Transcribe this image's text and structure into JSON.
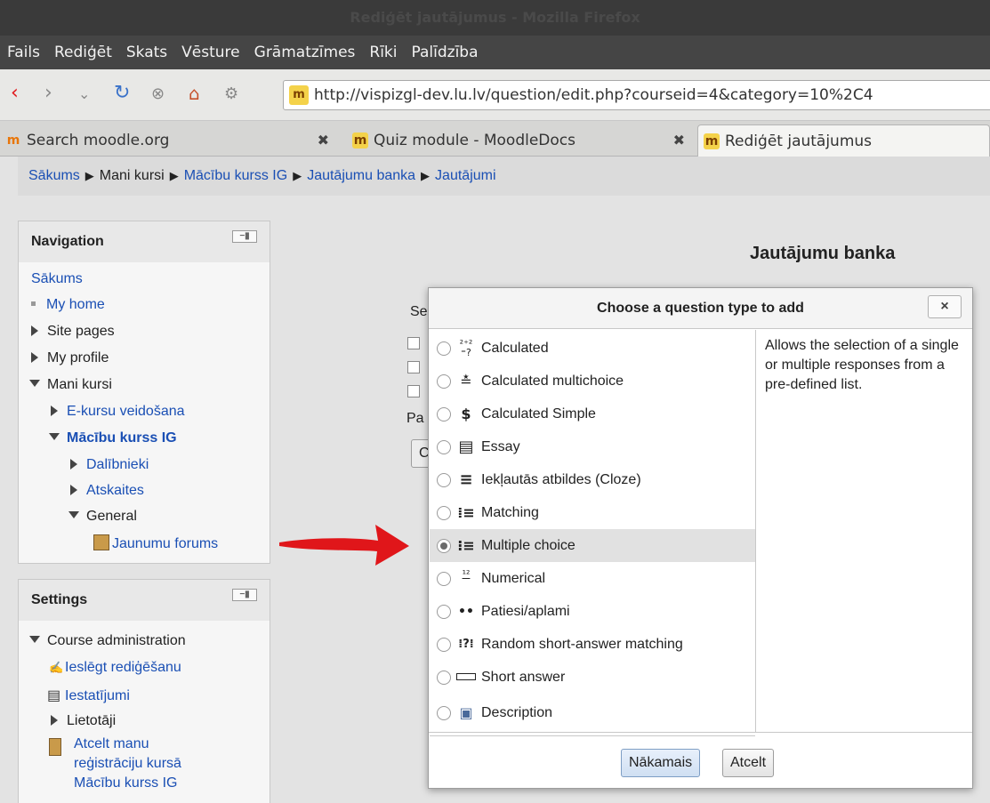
{
  "window": {
    "title": "Rediģēt jautājumus - Mozilla Firefox"
  },
  "menubar": {
    "items": [
      "Fails",
      "Rediģēt",
      "Skats",
      "Vēsture",
      "Grāmatzīmes",
      "Rīki",
      "Palīdzība"
    ]
  },
  "urlbar": {
    "url": "http://vispizgl-dev.lu.lv/question/edit.php?courseid=4&category=10%2C4"
  },
  "tabs": [
    {
      "label": "Search moodle.org",
      "icon": "moodle-org-favicon"
    },
    {
      "label": "Quiz module - MoodleDocs",
      "icon": "moodle-favicon"
    },
    {
      "label": "Rediģēt jautājumus",
      "icon": "moodle-favicon"
    }
  ],
  "breadcrumb": [
    {
      "label": "Sākums",
      "link": true
    },
    {
      "label": "Mani kursi",
      "link": false
    },
    {
      "label": "Mācību kurss IG",
      "link": true
    },
    {
      "label": "Jautājumu banka",
      "link": true
    },
    {
      "label": "Jautājumi",
      "link": true
    }
  ],
  "breadcrumb_separator": "▶",
  "navigation": {
    "title": "Navigation",
    "items": [
      {
        "label": "Sākums"
      },
      {
        "label": "My home"
      },
      {
        "label": "Site pages"
      },
      {
        "label": "My profile"
      },
      {
        "label": "Mani kursi"
      },
      {
        "label": "E-kursu veidošana"
      },
      {
        "label": "Mācību kurss IG"
      },
      {
        "label": "Dalībnieki"
      },
      {
        "label": "Atskaites"
      },
      {
        "label": "General"
      },
      {
        "label": "Jaunumu forums"
      }
    ]
  },
  "settings": {
    "title": "Settings",
    "items": [
      {
        "label": "Course administration"
      },
      {
        "label": "Ieslēgt rediģēšanu"
      },
      {
        "label": "Iestatījumi"
      },
      {
        "label": "Lietotāji"
      },
      {
        "label": "Atcelt manu"
      },
      {
        "label": "reģistrāciju kursā"
      },
      {
        "label": "Mācību kurss IG"
      }
    ]
  },
  "main": {
    "title": "Jautājumu banka",
    "partial_texts": [
      "Se",
      "Pa",
      "C"
    ]
  },
  "modal": {
    "title": "Choose a question type to add",
    "close": "×",
    "options": [
      {
        "label": "Calculated",
        "icon": "calculated-icon",
        "glyph": "²⁺²⁼?"
      },
      {
        "label": "Calculated multichoice",
        "icon": "calculated-multichoice-icon",
        "glyph": "≛"
      },
      {
        "label": "Calculated Simple",
        "icon": "calculated-simple-icon",
        "glyph": "$²"
      },
      {
        "label": "Essay",
        "icon": "essay-icon",
        "glyph": "▤"
      },
      {
        "label": "Iekļautās atbildes (Cloze)",
        "icon": "cloze-icon",
        "glyph": "≡"
      },
      {
        "label": "Matching",
        "icon": "matching-icon",
        "glyph": "⁞≡"
      },
      {
        "label": "Multiple choice",
        "icon": "multiple-choice-icon",
        "glyph": "⁝☰"
      },
      {
        "label": "Numerical",
        "icon": "numerical-icon",
        "glyph": "¹²"
      },
      {
        "label": "Patiesi/aplami",
        "icon": "true-false-icon",
        "glyph": "• •"
      },
      {
        "label": "Random short-answer matching",
        "icon": "random-matching-icon",
        "glyph": "⁞?⁞"
      },
      {
        "label": "Short answer",
        "icon": "short-answer-icon",
        "glyph": "▭"
      },
      {
        "label": "Description",
        "icon": "description-icon",
        "glyph": "▣"
      }
    ],
    "selected": "Multiple choice",
    "description": "Allows the selection of a single or multiple responses from a pre-defined list.",
    "next_button": "Nākamais",
    "cancel_button": "Atcelt"
  },
  "colors": {
    "link": "#1a4fb4",
    "arrow": "#e0161a",
    "selected_row": "#e1e1e1"
  }
}
